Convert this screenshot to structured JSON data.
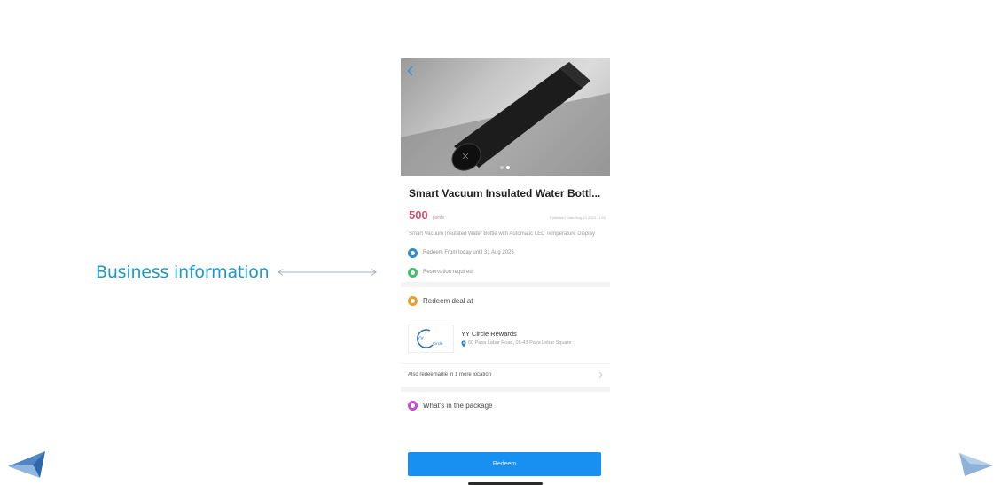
{
  "annotation": {
    "label": "Business information",
    "color": "#1c98c7"
  },
  "product": {
    "title": "Smart Vacuum Insulated Water Bottl...",
    "points_value": "500",
    "points_unit": "points",
    "published": "Published Date: Aug 10 2024 17:50",
    "description": "Smart Vacuum Insulated Water Bottle with Automatic LED Temperature Display",
    "carousel_total": 2,
    "carousel_active": 1
  },
  "info_rows": [
    {
      "icon": "calendar-icon",
      "color": "#2a8fc8",
      "text": "Redeem From today until 31 Aug 2025"
    },
    {
      "icon": "reservation-icon",
      "color": "#3fbf6a",
      "text": "Reservation required"
    }
  ],
  "redeem_at": {
    "icon": "store-icon",
    "color": "#ee9b2a",
    "label": "Redeem deal at",
    "merchant_name": "YY Circle Rewards",
    "merchant_address": "60 Pasa Labar Road, 05-43 Paya Lebar Square",
    "logo_initials": "YY",
    "logo_word": "Circle",
    "also_redeemable": "Also redeemable in 1 more location"
  },
  "package": {
    "icon": "package-icon",
    "color": "#c24ccc",
    "label": "What's in the package"
  },
  "actions": {
    "redeem_label": "Redeem",
    "redeem_color": "#1890f2"
  }
}
